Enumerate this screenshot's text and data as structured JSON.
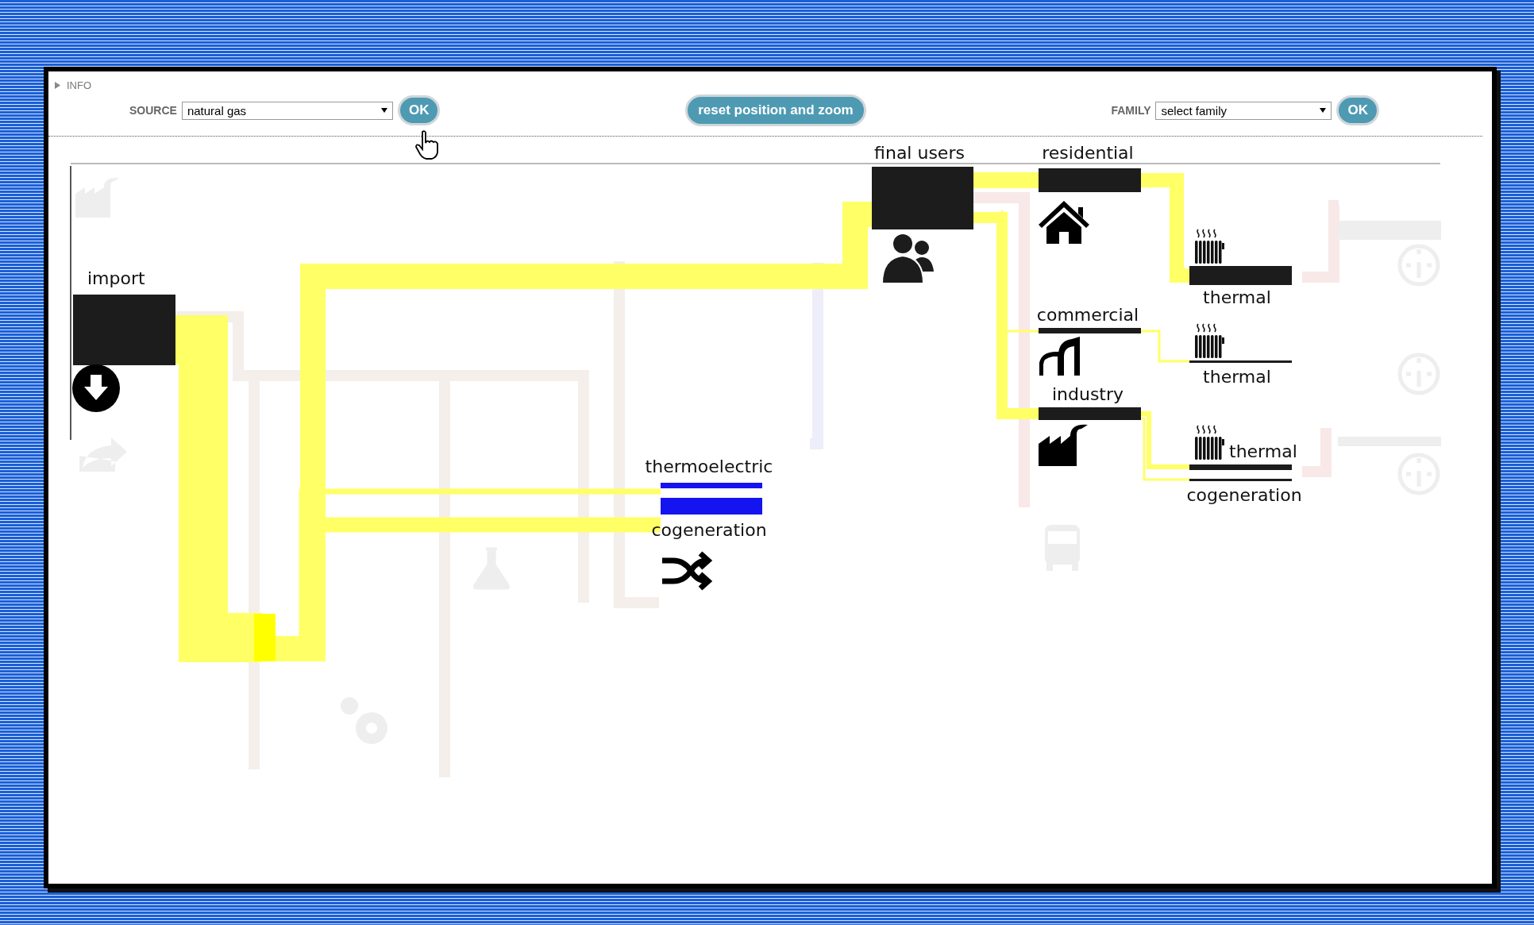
{
  "info": "INFO",
  "source": {
    "label": "SOURCE",
    "value": "natural gas",
    "button": "OK"
  },
  "reset_button": "reset position and zoom",
  "family": {
    "label": "FAMILY",
    "value": "select family",
    "button": "OK"
  },
  "diagram": {
    "nodes": [
      {
        "label": "import",
        "color": "#1c1c1c"
      },
      {
        "label": "final users",
        "color": "#1c1c1c"
      },
      {
        "label": "residential",
        "color": "#1c1c1c"
      },
      {
        "label": "commercial",
        "color": "#1c1c1c"
      },
      {
        "label": "industry",
        "color": "#1c1c1c"
      },
      {
        "label": "thermal",
        "color": "#1c1c1c"
      },
      {
        "label": "thermal",
        "color": "#1c1c1c"
      },
      {
        "label": "thermal",
        "color": "#1c1c1c"
      },
      {
        "label": "cogeneration",
        "color": "#1c1c1c"
      },
      {
        "label": "thermoelectric",
        "color": "#1414f0"
      },
      {
        "label": "cogeneration",
        "color": "#1414f0"
      }
    ]
  }
}
